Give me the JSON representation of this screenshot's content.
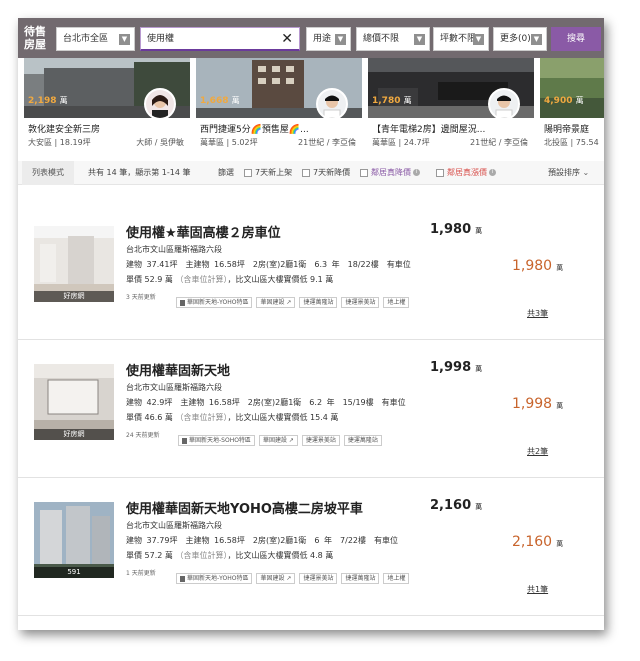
{
  "topbar": {
    "label_line1": "待售",
    "label_line2": "房屋",
    "region": "台北市全區",
    "search_value": "使用權",
    "clear_icon": "close-icon",
    "usage": "用途",
    "total_price": "總價不限",
    "ping": "坪數不限",
    "more": "更多(0)",
    "search_button": "搜尋"
  },
  "carousel": [
    {
      "price": "2,198",
      "unit": "萬",
      "title": "敦化建安全新三房",
      "sub": "大安區 | 18.19坪",
      "agent": "大師 / 吳伊敏"
    },
    {
      "price": "1,668",
      "unit": "萬",
      "title": "西門捷運5分🌈預售屋🌈...",
      "sub": "萬華區 | 5.02坪",
      "agent": "21世紀 / 李亞倫"
    },
    {
      "price": "1,780",
      "unit": "萬",
      "title": "【青年電梯2房】邊間屋況...",
      "sub": "萬華區 | 24.7坪",
      "agent": "21世紀 / 李亞倫"
    },
    {
      "price": "4,900",
      "unit": "萬",
      "title": "陽明帝景庭",
      "sub": "北投區 | 75.54",
      "agent": ""
    }
  ],
  "filters": {
    "mode": "列表模式",
    "count": "共有 14 筆，顯示第 1-14 筆",
    "filter_label": "篩選",
    "opt1": "7天新上架",
    "opt2": "7天新降價",
    "opt3": "鄰居真降價",
    "opt4": "鄰居真漲價",
    "sort": "預設排序"
  },
  "listings": [
    {
      "title": "使用權★華固高樓２房車位",
      "price": "1,980",
      "unit": "萬",
      "address": "台北市文山區羅斯福路六段",
      "spec": "建物 37.41坪　主建物 16.58坪　2房(室)2廳1衛　6.3 年　18/22樓　有車位",
      "unit_price": "單價 52.9 萬",
      "unit_note": "（含車位計算）",
      "compare": "，比文山區大樓實價低 9.1 萬",
      "updated": "3 天前更新",
      "tags": [
        "華固新天地-YOHO特區",
        "華固建設",
        "捷運萬隆站",
        "捷運景美站",
        "地上權"
      ],
      "thumb_caption": "好房網",
      "right_price": "1,980",
      "more": "共3筆"
    },
    {
      "title": "使用權華固新天地",
      "price": "1,998",
      "unit": "萬",
      "address": "台北市文山區羅斯福路六段",
      "spec": "建物 42.9坪　主建物 16.58坪　2房(室)2廳1衛　6.2 年　15/19樓　有車位",
      "unit_price": "單價 46.6 萬",
      "unit_note": "（含車位計算）",
      "compare": "，比文山區大樓實價低 15.4 萬",
      "updated": "24 天前更新",
      "tags": [
        "華固新天地-SOHO特區",
        "華固建設",
        "捷運景美站",
        "捷運萬隆站"
      ],
      "thumb_caption": "好房網",
      "right_price": "1,998",
      "more": "共2筆"
    },
    {
      "title": "使用權華固新天地YOHO高樓二房坡平車",
      "price": "2,160",
      "unit": "萬",
      "address": "台北市文山區羅斯福路六段",
      "spec": "建物 37.79坪　主建物 16.58坪　2房(室)2廳1衛　6 年　7/22樓　有車位",
      "unit_price": "單價 57.2 萬",
      "unit_note": "（含車位計算）",
      "compare": "，比文山區大樓實價低 4.8 萬",
      "updated": "1 天前更新",
      "tags": [
        "華固新天地-YOHO特區",
        "華固建設",
        "捷運景美站",
        "捷運萬隆站",
        "地上權"
      ],
      "thumb_caption": "591",
      "right_price": "2,160",
      "more": "共1筆"
    }
  ]
}
